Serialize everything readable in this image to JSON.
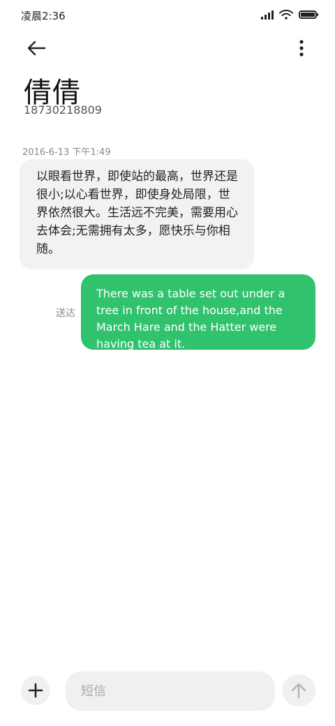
{
  "status_bar": {
    "time": "凌晨2:36",
    "icons": [
      "signal-icon",
      "wifi-icon",
      "battery-icon"
    ]
  },
  "header": {
    "back_icon": "back-arrow-icon",
    "more_icon": "more-vertical-icon",
    "contact_name": "倩倩",
    "contact_number": "18730218809"
  },
  "conversation": {
    "timestamp": "2016-6-13 下午1:49",
    "incoming": {
      "text": "以眼看世界，即使站的最高，世界还是很小;以心看世界，即使身处局限，世界依然很大。生活远不完美，需要用心去体会;无需拥有太多，愿快乐与你相随。"
    },
    "outgoing": {
      "status": "送达",
      "text": "There was a table set out under a tree in front of the house,and the March Hare and the Hatter were having tea at it."
    }
  },
  "composer": {
    "add_icon": "plus-icon",
    "placeholder": "短信",
    "value": "",
    "send_icon": "arrow-up-icon"
  },
  "colors": {
    "outgoing_bubble": "#31c26e",
    "incoming_bubble": "#f2f2f2",
    "composer_bg": "#f0f0f0"
  }
}
